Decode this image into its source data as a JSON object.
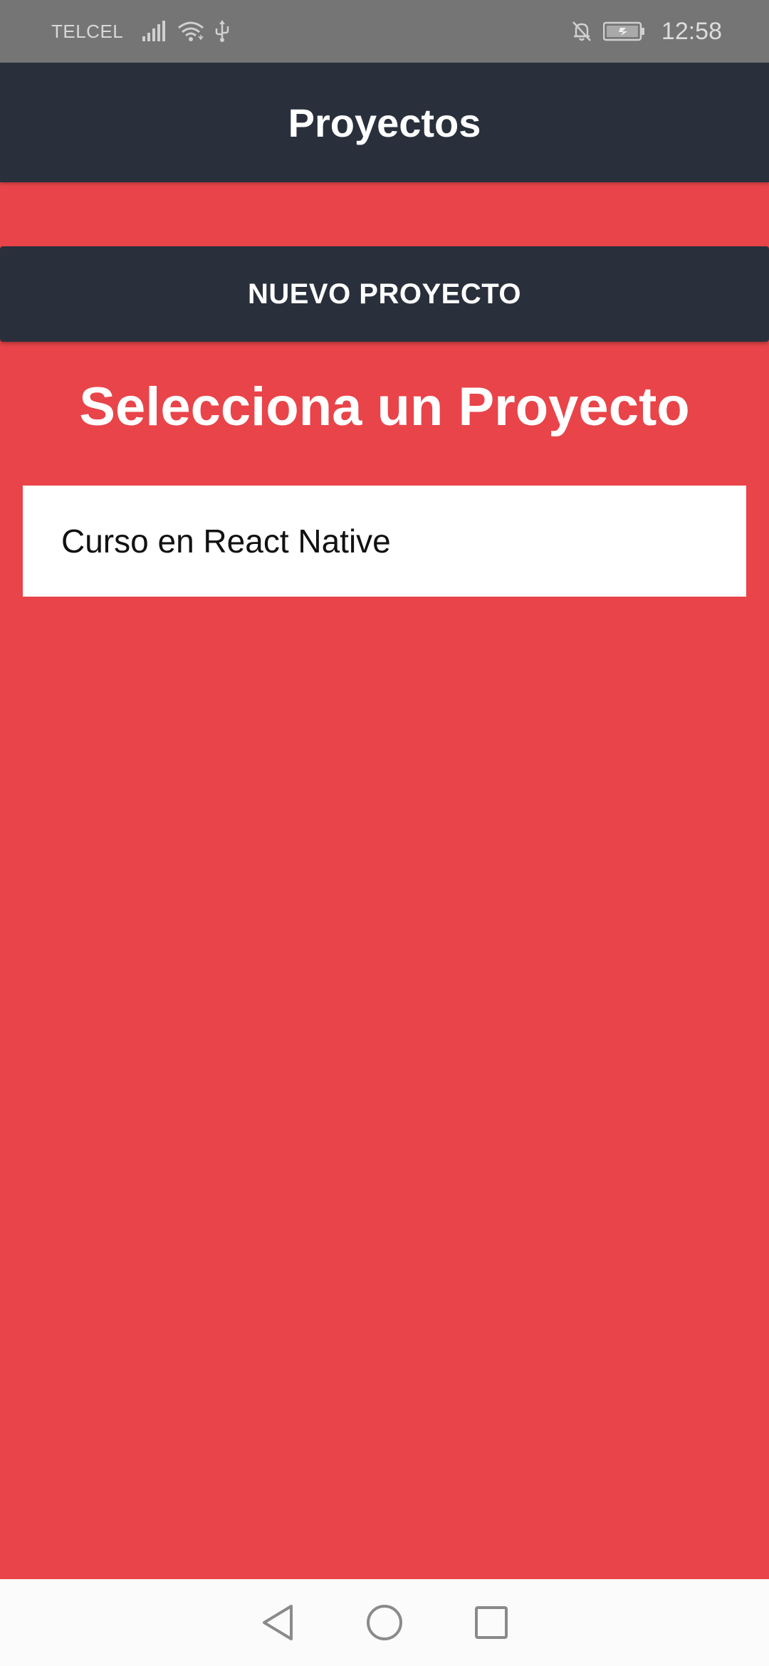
{
  "status_bar": {
    "carrier": "TELCEL",
    "time": "12:58",
    "icons": [
      "signal-icon",
      "wifi-icon",
      "usb-icon",
      "notifications-off-icon",
      "battery-charging-icon"
    ]
  },
  "header": {
    "title": "Proyectos"
  },
  "actions": {
    "new_project_label": "NUEVO PROYECTO"
  },
  "main": {
    "heading": "Selecciona un Proyecto",
    "projects": [
      {
        "name": "Curso en React Native"
      }
    ]
  },
  "nav_bar": {
    "buttons": [
      "back-icon",
      "home-icon",
      "recents-icon"
    ]
  },
  "colors": {
    "background": "#e84449",
    "header": "#29303c",
    "status_bar": "#757575",
    "list_item": "#ffffff"
  }
}
